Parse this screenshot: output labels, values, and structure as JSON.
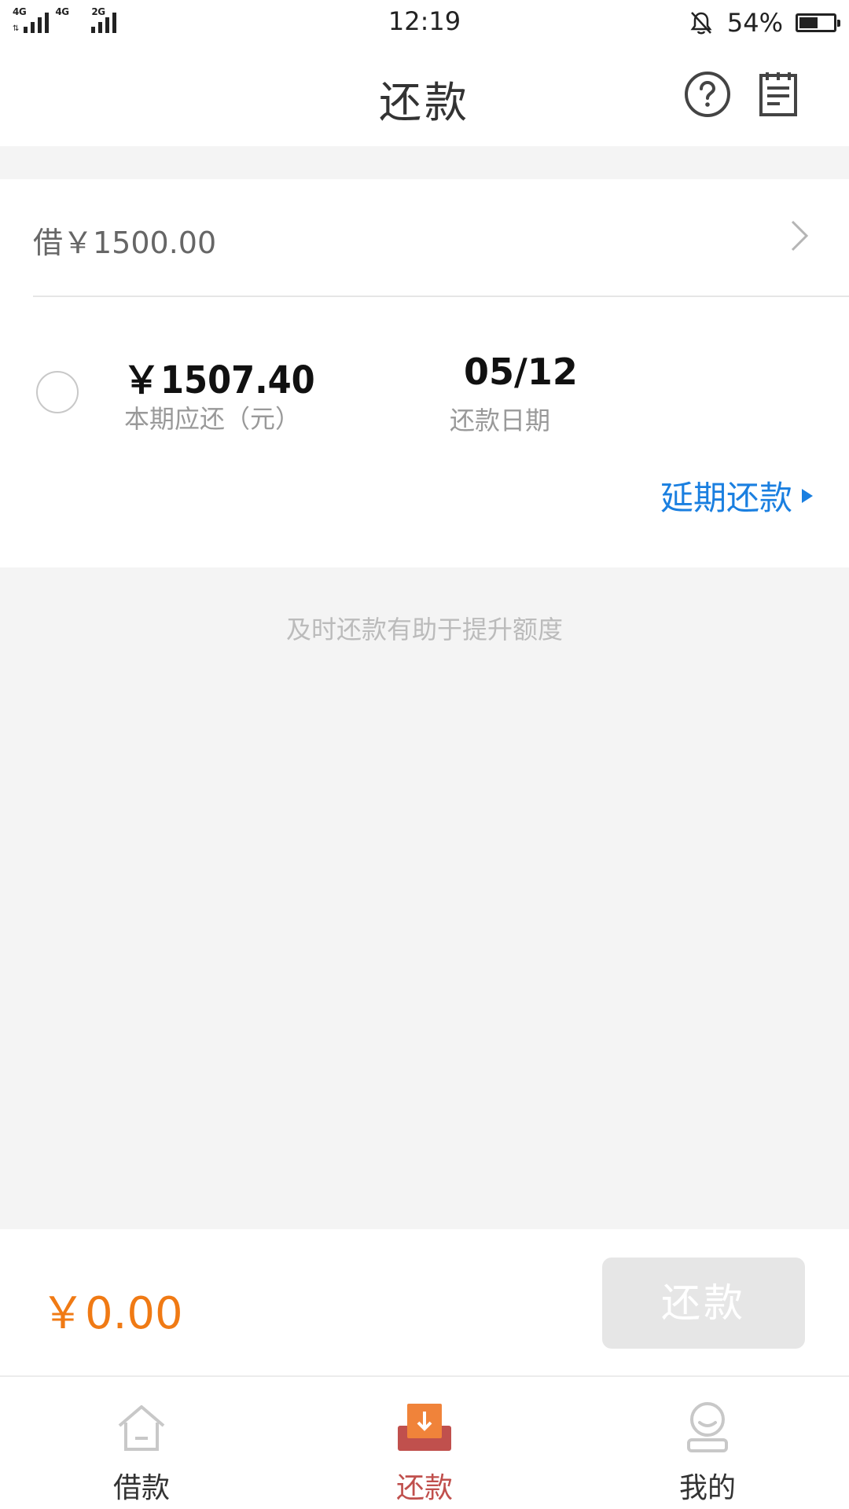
{
  "status_bar": {
    "network_1": "4G",
    "network_2": "4G",
    "network_3": "2G",
    "time": "12:19",
    "battery": "54%",
    "battery_level": 0.54
  },
  "header": {
    "title": "还款",
    "help_icon": "question-circle-icon",
    "bill_icon": "document-list-icon"
  },
  "loan": {
    "label": "借￥1500.00"
  },
  "installment": {
    "amount": "￥1507.40",
    "amount_label": "本期应还（元）",
    "due_date": "05/12",
    "due_label": "还款日期",
    "defer_link": "延期还款"
  },
  "hint": "及时还款有助于提升额度",
  "payment": {
    "total": "￥0.00",
    "button": "还款"
  },
  "tabs": [
    {
      "label": "借款",
      "icon": "house-icon",
      "active": false
    },
    {
      "label": "还款",
      "icon": "repay-download-icon",
      "active": true
    },
    {
      "label": "我的",
      "icon": "profile-icon",
      "active": false
    }
  ],
  "colors": {
    "accent_orange": "#f07a14",
    "link_blue": "#1a7fe0",
    "active_tab": "#c0504d",
    "disabled_button": "#e6e6e6"
  }
}
